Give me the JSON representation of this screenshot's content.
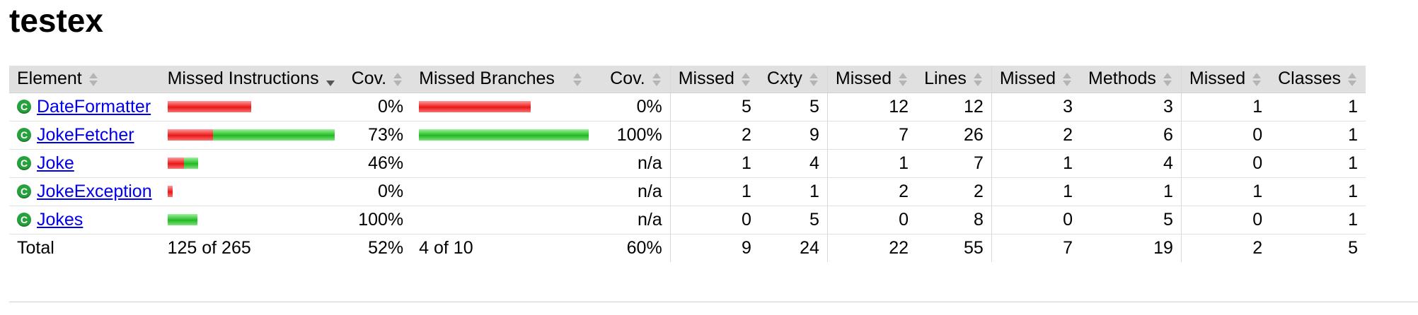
{
  "page": {
    "title": "testex"
  },
  "table": {
    "headers": {
      "element": "Element",
      "missed_instructions": "Missed Instructions",
      "cov1": "Cov.",
      "missed_branches": "Missed Branches",
      "cov2": "Cov.",
      "missed_cxty": "Missed",
      "cxty": "Cxty",
      "missed_lines": "Missed",
      "lines": "Lines",
      "missed_methods": "Missed",
      "methods": "Methods",
      "missed_classes": "Missed",
      "classes": "Classes"
    },
    "rows": [
      {
        "name": "DateFormatter",
        "instr_missed_fraction": 1.0,
        "instr_covered_fraction": 0.0,
        "instr_cov": "0%",
        "branch_missed_fraction": 1.0,
        "branch_covered_fraction": 0.0,
        "branch_cov": "0%",
        "missed_cxty": "5",
        "cxty": "5",
        "missed_lines": "12",
        "lines": "12",
        "missed_methods": "3",
        "methods": "3",
        "missed_classes": "1",
        "classes": "1"
      },
      {
        "name": "JokeFetcher",
        "instr_missed_fraction": 0.27,
        "instr_covered_fraction": 0.73,
        "instr_cov": "73%",
        "branch_missed_fraction": 0.0,
        "branch_covered_fraction": 1.0,
        "branch_cov": "100%",
        "missed_cxty": "2",
        "cxty": "9",
        "missed_lines": "7",
        "lines": "26",
        "missed_methods": "2",
        "methods": "6",
        "missed_classes": "0",
        "classes": "1"
      },
      {
        "name": "Joke",
        "instr_missed_fraction": 0.54,
        "instr_covered_fraction": 0.46,
        "instr_cov": "46%",
        "branch_missed_fraction": 0.0,
        "branch_covered_fraction": 0.0,
        "branch_cov": "n/a",
        "missed_cxty": "1",
        "cxty": "4",
        "missed_lines": "1",
        "lines": "7",
        "missed_methods": "1",
        "methods": "4",
        "missed_classes": "0",
        "classes": "1"
      },
      {
        "name": "JokeException",
        "instr_missed_fraction": 1.0,
        "instr_covered_fraction": 0.0,
        "instr_cov": "0%",
        "branch_missed_fraction": 0.0,
        "branch_covered_fraction": 0.0,
        "branch_cov": "n/a",
        "missed_cxty": "1",
        "cxty": "1",
        "missed_lines": "2",
        "lines": "2",
        "missed_methods": "1",
        "methods": "1",
        "missed_classes": "1",
        "classes": "1"
      },
      {
        "name": "Jokes",
        "instr_missed_fraction": 0.0,
        "instr_covered_fraction": 1.0,
        "instr_cov": "100%",
        "branch_missed_fraction": 0.0,
        "branch_covered_fraction": 0.0,
        "branch_cov": "n/a",
        "missed_cxty": "0",
        "cxty": "5",
        "missed_lines": "0",
        "lines": "8",
        "missed_methods": "0",
        "methods": "5",
        "missed_classes": "0",
        "classes": "1"
      }
    ],
    "instr_bar_max_fraction": [
      0.5,
      1.0,
      0.18,
      0.03,
      0.18
    ],
    "branch_bar_max_fraction": [
      0.66,
      1.0,
      0.0,
      0.0,
      0.0
    ],
    "total": {
      "label": "Total",
      "instructions": "125 of 265",
      "instr_cov": "52%",
      "branches": "4 of 10",
      "branch_cov": "60%",
      "missed_cxty": "9",
      "cxty": "24",
      "missed_lines": "22",
      "lines": "55",
      "missed_methods": "7",
      "methods": "19",
      "missed_classes": "2",
      "classes": "5"
    },
    "colors": {
      "missed": "#e81818",
      "covered": "#22b822",
      "header_bg": "#e0e0e0",
      "link": "#0000ee"
    },
    "icons": {
      "class_icon": "class-c-icon",
      "sort_icon": "sort-arrows-icon"
    }
  }
}
